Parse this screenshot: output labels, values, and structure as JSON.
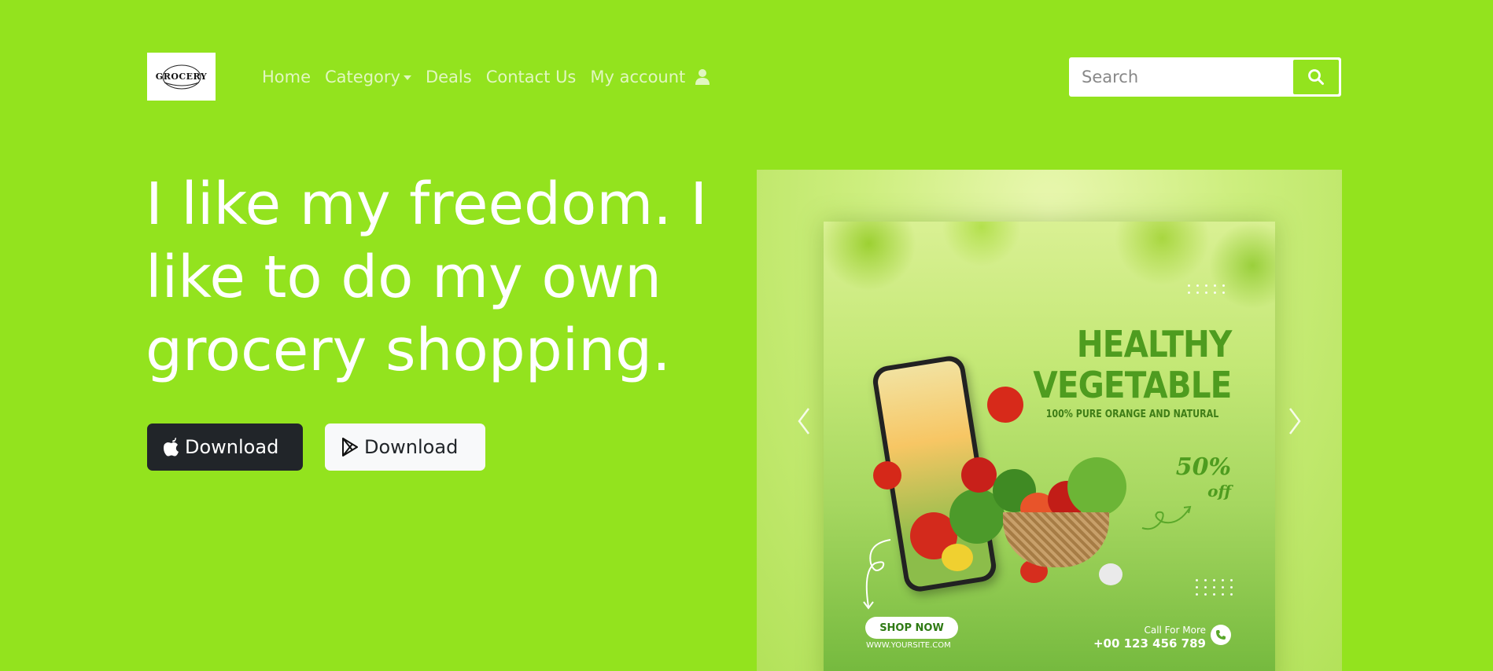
{
  "navbar": {
    "logo_text": "GROCERY",
    "items": [
      {
        "label": "Home"
      },
      {
        "label": "Category"
      },
      {
        "label": "Deals"
      },
      {
        "label": "Contact Us"
      },
      {
        "label": "My account"
      }
    ],
    "search_placeholder": "Search"
  },
  "hero": {
    "title": "I like my freedom. I like to do my own grocery shopping.",
    "apple_button_label": "Download",
    "play_button_label": "Download"
  },
  "carousel": {
    "slide": {
      "heading_line1": "HEALTHY",
      "heading_line2": "VEGETABLE",
      "subheading": "100% PURE ORANGE AND NATURAL",
      "discount": "50%",
      "discount_suffix": "off",
      "cta": "SHOP NOW",
      "website": "WWW.YOURSITE.COM",
      "call_label": "Call For More",
      "phone": "+00 123 456 789"
    }
  },
  "colors": {
    "background": "#93e31e",
    "dark_button": "#212529",
    "light_button": "#f8f9fa",
    "ad_green": "#4e9c1f"
  },
  "icons": {
    "user": "user-icon",
    "search": "search-icon",
    "apple": "apple-icon",
    "play": "google-play-icon",
    "prev": "chevron-left-icon",
    "next": "chevron-right-icon"
  }
}
